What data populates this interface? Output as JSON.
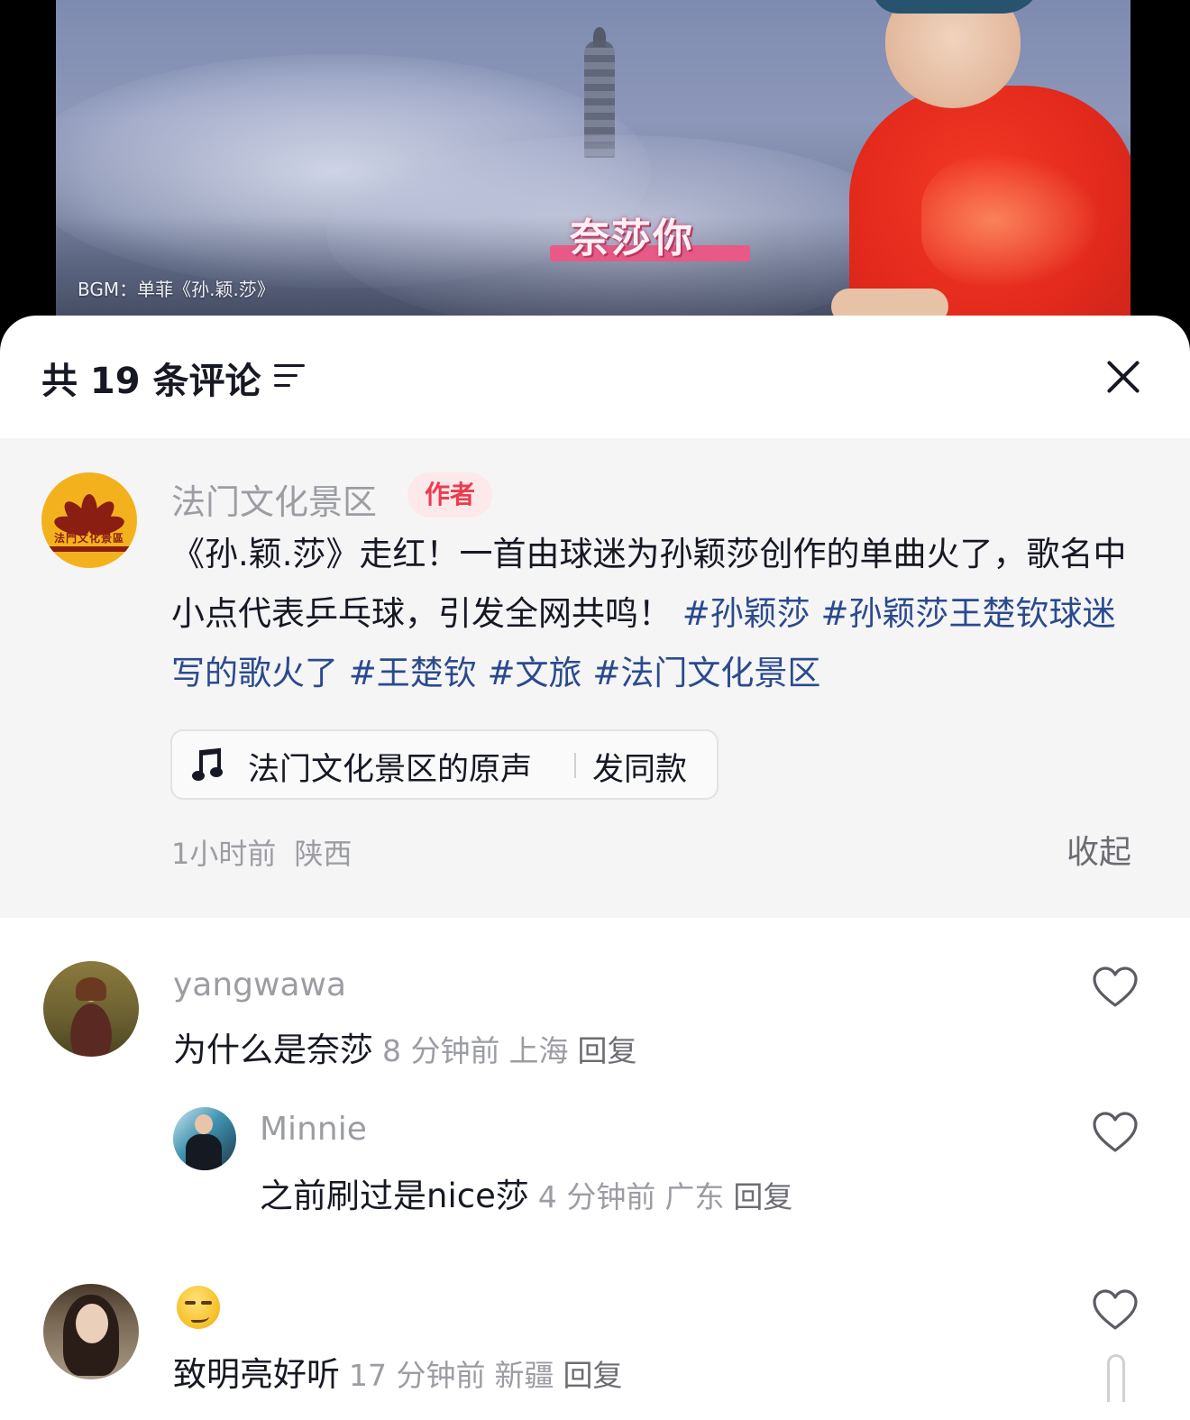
{
  "video": {
    "caption": "奈莎你",
    "bgm": "BGM：单菲《孙.颖.莎》"
  },
  "header": {
    "title": "共 19 条评论",
    "sort_icon": "sort-filter-icon",
    "close_icon": "close-icon"
  },
  "author_comment": {
    "name": "法门文化景区",
    "badge": "作者",
    "logo_text": "法門文化景區",
    "text_plain": "《孙.颖.莎》走红！一首由球迷为孙颖莎创作的单曲火了，歌名中小点代表乒乓球，引发全网共鸣！",
    "hashtags": [
      "#孙颖莎",
      "#孙颖莎王楚钦球迷写的歌火了",
      "#王楚钦",
      "#文旅",
      "#法门文化景区"
    ],
    "music_label": "法门文化景区的原声",
    "music_action": "发同款",
    "time": "1小时前",
    "location": "陕西",
    "collapse": "收起"
  },
  "comments": [
    {
      "user": "yangwawa",
      "text": "为什么是奈莎",
      "time": "8 分钟前",
      "location": "上海",
      "reply": "回复"
    },
    {
      "user": "Minnie",
      "text": "之前刷过是nice莎",
      "time": "4 分钟前",
      "location": "广东",
      "reply": "回复"
    },
    {
      "user_emoji": "smirk-emoji",
      "text": "致明亮好听",
      "time": "17 分钟前",
      "location": "新疆",
      "reply": "回复"
    }
  ],
  "colors": {
    "hashtag": "#2b4a8d",
    "badge_bg": "#fde8ea",
    "badge_text": "#ea3d4f",
    "muted": "#9c9da3",
    "highlight_bg": "#f5f5f6"
  }
}
